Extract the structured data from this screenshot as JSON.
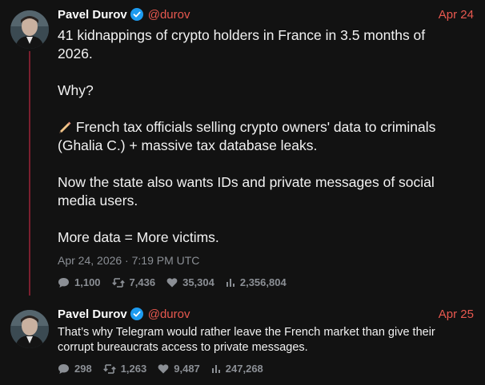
{
  "colors": {
    "background": "#121212",
    "accent_handle": "#e8584f",
    "verified_badge": "#1d9bf0",
    "thread_line": "#7a1f2e",
    "muted": "#8b8f95"
  },
  "posts": [
    {
      "author_name": "Pavel Durov",
      "handle": "@durov",
      "date": "Apr 24",
      "paragraphs": [
        "41 kidnappings of crypto holders in France in 3.5 months of 2026.",
        "Why?",
        "French tax officials selling crypto owners' data to criminals (Ghalia C.) + massive tax database leaks.",
        "Now the state also wants IDs and private messages of social media users.",
        "More data = More victims."
      ],
      "paragraph_3_icon": "pencil-icon",
      "timestamp": "Apr 24, 2026 · 7:19 PM UTC",
      "stats": {
        "comments": "1,100",
        "retweets": "7,436",
        "likes": "35,304",
        "views": "2,356,804"
      }
    },
    {
      "author_name": "Pavel Durov",
      "handle": "@durov",
      "date": "Apr 25",
      "text": "That’s why Telegram would rather leave the French market than give their corrupt bureaucrats access to private messages.",
      "stats": {
        "comments": "298",
        "retweets": "1,263",
        "likes": "9,487",
        "views": "247,268"
      }
    }
  ]
}
